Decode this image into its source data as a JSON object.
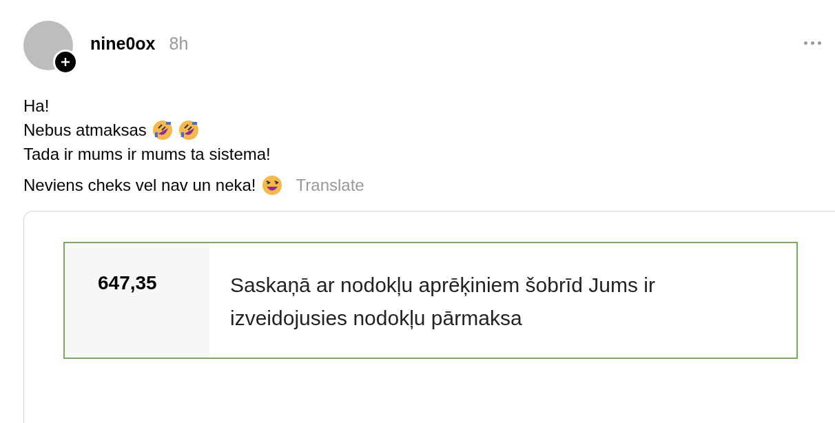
{
  "post": {
    "author": "nine0ox",
    "time": "8h",
    "lines": [
      {
        "text": "Ha!"
      },
      {
        "text": "Nebus atmaksas",
        "emojis": [
          {
            "kind": "rolling"
          },
          {
            "kind": "rolling"
          }
        ]
      },
      {
        "text": "Tada ir mums ir mums ta sistema!"
      }
    ],
    "last_line": {
      "text": "Neviens cheks vel nav un neka!",
      "emojis": [
        {
          "kind": "grinning"
        }
      ]
    },
    "translate": "Translate",
    "attachment": {
      "amount": "647,35",
      "message": "Saskaņā ar nodokļu aprēķiniem šobrīd Jums ir izveidojusies nodokļu pārmaksa"
    }
  }
}
